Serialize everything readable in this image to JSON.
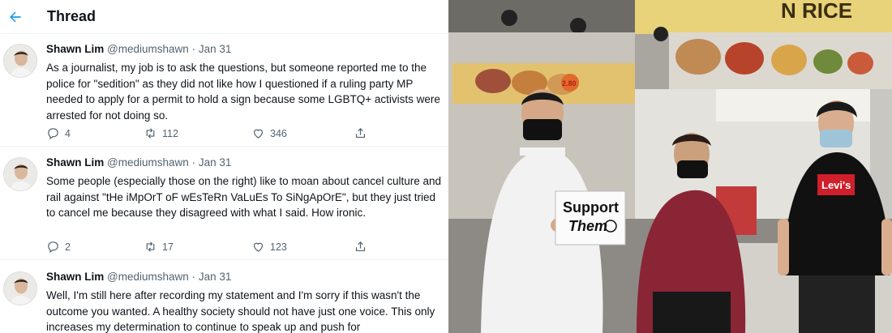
{
  "header": {
    "title": "Thread"
  },
  "tweets": [
    {
      "name": "Shawn Lim",
      "handle": "@mediumshawn",
      "separator": "·",
      "date": "Jan 31",
      "text": "As a journalist, my job is to ask the questions, but someone reported me to the police for \"sedition\" as they did not like how I questioned if a ruling party MP needed to apply for a permit to hold a sign because some LGBTQ+ activists were arrested for not doing so.",
      "replies": "4",
      "retweets": "112",
      "likes": "346"
    },
    {
      "name": "Shawn Lim",
      "handle": "@mediumshawn",
      "separator": "·",
      "date": "Jan 31",
      "text": "Some people (especially those on the right) like to moan about cancel culture and rail against \"tHe iMpOrT oF wEsTeRn VaLuEs To SiNgApOrE\", but they just tried to cancel me because they disagreed with what I said. How ironic.",
      "replies": "2",
      "retweets": "17",
      "likes": "123"
    },
    {
      "name": "Shawn Lim",
      "handle": "@mediumshawn",
      "separator": "·",
      "date": "Jan 31",
      "text": "Well, I'm still here after recording my statement and I'm sorry if this wasn't the outcome you wanted. A healthy society should not have just one voice. This only increases my determination to continue to speak up and push for"
    }
  ],
  "photo": {
    "sign_line1": "Support",
    "sign_line2": "Them",
    "shirt_logo": "Levi's",
    "stall_sign": "N RICE",
    "menu_badge": "2.80"
  },
  "colors": {
    "accent": "#1d9bf0",
    "secondary_text": "#536471"
  }
}
